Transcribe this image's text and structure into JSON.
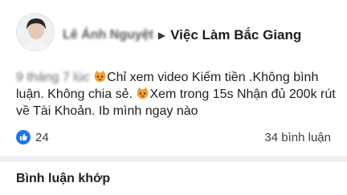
{
  "header": {
    "author": "Lê Ánh Nguyệt",
    "separator_icon": "triangle-right-icon",
    "group": "Việc Làm Bắc Giang"
  },
  "post": {
    "date_blurred": "9 tháng 7 lúc",
    "emoji_icon": "cat-face-icon",
    "text_part1": "Chỉ xem video Kiếm tiền .Không bình luận. Không chia sẻ. ",
    "text_part2": "Xem trong 15s Nhận đủ 200k rút về Tài Khoản. Ib mình ngay nào"
  },
  "stats": {
    "like_icon": "like-reaction-icon",
    "like_count": "24",
    "comments": "34 bình luận",
    "like_color": "#1877f2"
  },
  "comments_section": {
    "title": "Bình luận khớp"
  }
}
